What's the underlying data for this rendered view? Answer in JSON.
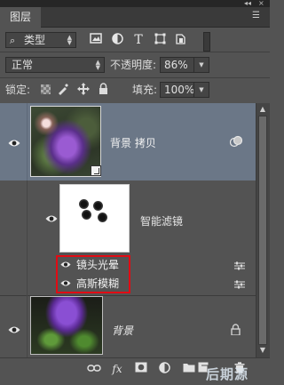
{
  "panel": {
    "tab_label": "图层"
  },
  "filter": {
    "kind_label": "类型"
  },
  "blend": {
    "mode": "正常",
    "opacity_label": "不透明度:",
    "opacity_value": "86%"
  },
  "lock": {
    "label": "锁定:",
    "fill_label": "填充:",
    "fill_value": "100%"
  },
  "layers": {
    "copy": {
      "name": "背景 拷贝"
    },
    "smart_filters": {
      "label": "智能滤镜",
      "filters": [
        {
          "name": "镜头光晕"
        },
        {
          "name": "高斯模糊"
        }
      ]
    },
    "background": {
      "name": "背景"
    }
  },
  "watermark": "后期源",
  "colors": {
    "panel_bg": "#535353",
    "selected_row": "#6b7787",
    "highlight_border": "#e10b14"
  }
}
